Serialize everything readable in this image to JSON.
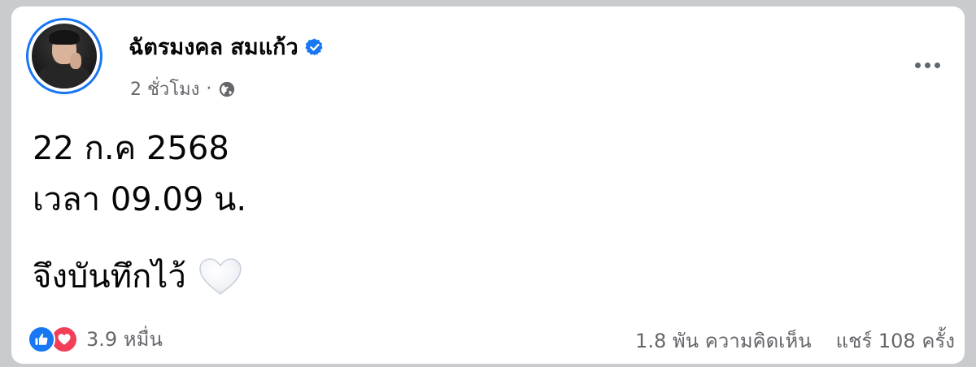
{
  "post": {
    "author": {
      "name": "ฉัตรมงคล สมแก้ว",
      "verified": true
    },
    "meta": {
      "time": "2 ชั่วโมง",
      "separator": "·",
      "audience_icon": "globe-icon"
    },
    "content": {
      "line1": "22 ก.ค 2568",
      "line2": "เวลา 09.09 น.",
      "line3": "จึงบันทึกไว้",
      "emoji_icon": "white-heart-icon"
    },
    "reactions": {
      "icons": [
        "like-icon",
        "love-icon"
      ],
      "count": "3.9 หมื่น"
    },
    "stats": {
      "comments": "1.8 พัน ความคิดเห็น",
      "shares": "แชร์ 108 ครั้ง"
    }
  },
  "colors": {
    "accent": "#1877f2",
    "love": "#f33e58",
    "secondary_text": "#65676b",
    "primary_text": "#050505"
  }
}
